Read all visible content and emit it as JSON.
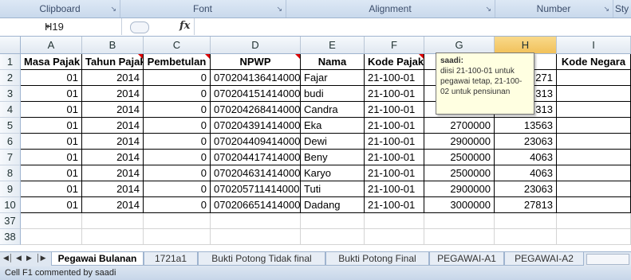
{
  "ribbon": {
    "groups": [
      "Clipboard",
      "Font",
      "Alignment",
      "Number",
      "Sty"
    ]
  },
  "formula_bar": {
    "name_box": "H19",
    "fx_label": "fx",
    "formula": ""
  },
  "columns": [
    "A",
    "B",
    "C",
    "D",
    "E",
    "F",
    "G",
    "H",
    "I"
  ],
  "selected_column": "H",
  "header_row": {
    "row_num": "1",
    "cells": [
      "Masa Pajak",
      "Tahun Pajak",
      "Pembetulan",
      "NPWP",
      "Nama",
      "Kode Pajak",
      "Ju",
      "lPh",
      "Kode Negara"
    ]
  },
  "rows": [
    {
      "num": "2",
      "cells": [
        "01",
        "2014",
        "0",
        "070204136414000",
        "Fajar",
        "21-100-01",
        "",
        "271",
        ""
      ]
    },
    {
      "num": "3",
      "cells": [
        "01",
        "2014",
        "0",
        "070204151414000",
        "budi",
        "21-100-01",
        "",
        "313",
        ""
      ]
    },
    {
      "num": "4",
      "cells": [
        "01",
        "2014",
        "0",
        "070204268414000",
        "Candra",
        "21-100-01",
        "",
        "313",
        ""
      ]
    },
    {
      "num": "5",
      "cells": [
        "01",
        "2014",
        "0",
        "070204391414000",
        "Eka",
        "21-100-01",
        "2700000",
        "13563",
        ""
      ]
    },
    {
      "num": "6",
      "cells": [
        "01",
        "2014",
        "0",
        "070204409414000",
        "Dewi",
        "21-100-01",
        "2900000",
        "23063",
        ""
      ]
    },
    {
      "num": "7",
      "cells": [
        "01",
        "2014",
        "0",
        "070204417414000",
        "Beny",
        "21-100-01",
        "2500000",
        "4063",
        ""
      ]
    },
    {
      "num": "8",
      "cells": [
        "01",
        "2014",
        "0",
        "070204631414000",
        "Karyo",
        "21-100-01",
        "2500000",
        "4063",
        ""
      ]
    },
    {
      "num": "9",
      "cells": [
        "01",
        "2014",
        "0",
        "070205711414000",
        "Tuti",
        "21-100-01",
        "2900000",
        "23063",
        ""
      ]
    },
    {
      "num": "10",
      "cells": [
        "01",
        "2014",
        "0",
        "070206651414000",
        "Dadang",
        "21-100-01",
        "3000000",
        "27813",
        ""
      ]
    },
    {
      "num": "37",
      "cells": [
        "",
        "",
        "",
        "",
        "",
        "",
        "",
        "",
        ""
      ]
    },
    {
      "num": "38",
      "cells": [
        "",
        "",
        "",
        "",
        "",
        "",
        "",
        "",
        ""
      ]
    }
  ],
  "comment": {
    "author": "saadi:",
    "text": "diisi 21-100-01 untuk pegawai tetap, 21-100-02 untuk pensiunan"
  },
  "sheet_tabs": [
    "Pegawai Bulanan",
    "1721a1",
    "Bukti Potong  Tidak final",
    "Bukti Potong Final",
    "PEGAWAI-A1",
    "PEGAWAI-A2"
  ],
  "active_tab": "Pegawai Bulanan",
  "status_bar": {
    "text": "Cell F1 commented by saadi"
  },
  "colors": {
    "selected_header": "#f1c15a",
    "comment_bg": "#ffffe1",
    "comment_marker": "#dd0000"
  }
}
